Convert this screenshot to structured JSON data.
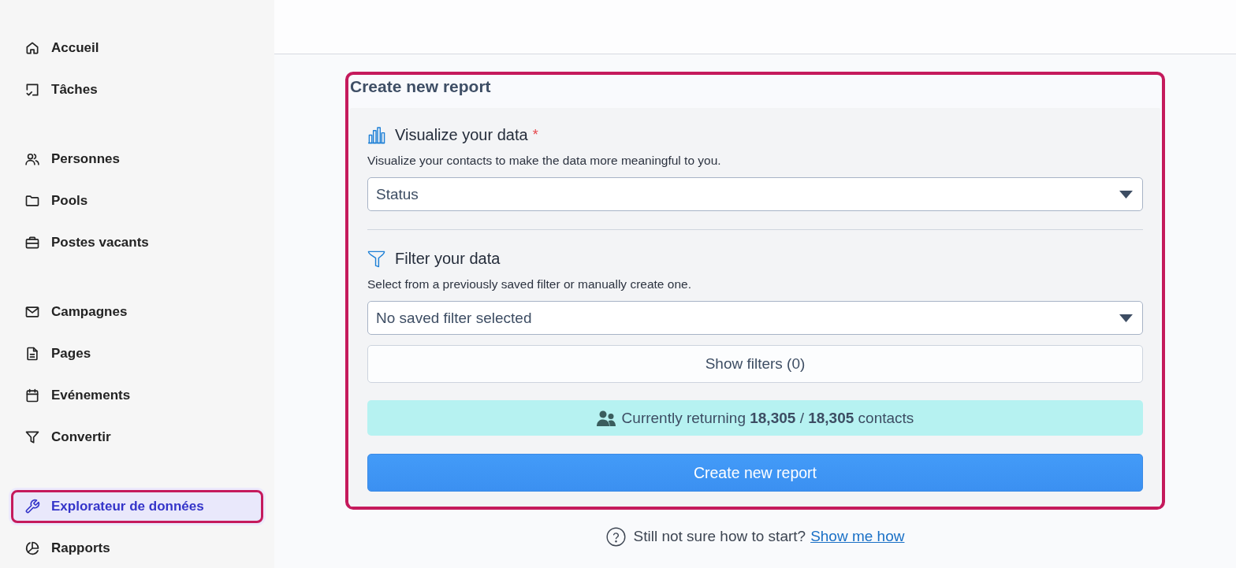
{
  "sidebar": {
    "groups": [
      {
        "items": [
          {
            "label": "Accueil",
            "selected": false,
            "highlighted": false
          },
          {
            "label": "Tâches",
            "selected": false,
            "highlighted": false
          }
        ]
      },
      {
        "items": [
          {
            "label": "Personnes",
            "selected": false,
            "highlighted": false
          },
          {
            "label": "Pools",
            "selected": false,
            "highlighted": false
          },
          {
            "label": "Postes vacants",
            "selected": false,
            "highlighted": false
          }
        ]
      },
      {
        "items": [
          {
            "label": "Campagnes",
            "selected": false,
            "highlighted": false
          },
          {
            "label": "Pages",
            "selected": false,
            "highlighted": false
          },
          {
            "label": "Evénements",
            "selected": false,
            "highlighted": false
          },
          {
            "label": "Convertir",
            "selected": false,
            "highlighted": false
          }
        ]
      },
      {
        "items": [
          {
            "label": "Explorateur de données",
            "selected": true,
            "highlighted": true
          },
          {
            "label": "Rapports",
            "selected": false,
            "highlighted": false
          }
        ]
      }
    ]
  },
  "report": {
    "title": "Create new report",
    "highlighted": true,
    "sections": [
      {
        "heading": "Visualize your data",
        "required_mark": "*",
        "description": "Visualize your contacts to make the data more meaningful to you.",
        "select": {
          "value": "Status"
        }
      },
      {
        "heading": "Filter your data",
        "description": "Select from a previously saved filter or manually create one.",
        "select": {
          "value": "No saved filter selected"
        },
        "button": "Show filters (0)"
      }
    ],
    "result": "Currently returning **18,305** / **18,305** contacts",
    "submit": "Create new report"
  },
  "help": {
    "text": "Still not sure how to start?",
    "link": "Show me how"
  }
}
